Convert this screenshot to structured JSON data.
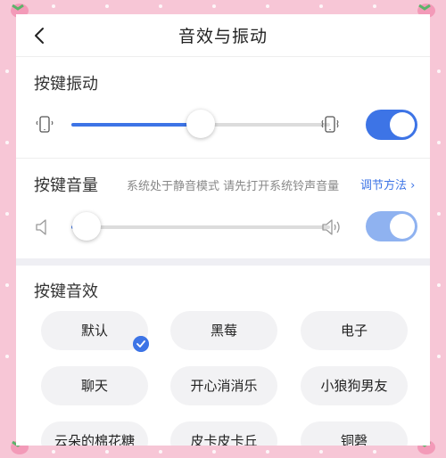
{
  "header": {
    "title": "音效与振动",
    "back_icon": "chevron-left-icon"
  },
  "vibration": {
    "title": "按键振动",
    "slider_level": 0.5,
    "toggle_on": true,
    "left_icon": "phone-vibrate-low-icon",
    "right_icon": "phone-vibrate-high-icon"
  },
  "volume": {
    "title": "按键音量",
    "hint": "系统处于静音模式 请先打开系统铃声音量",
    "link_label": "调节方法 ›",
    "slider_level": 0.06,
    "toggle_on": true,
    "left_icon": "speaker-low-icon",
    "right_icon": "speaker-high-icon"
  },
  "sound_effects": {
    "title": "按键音效",
    "selected": "默认",
    "options": [
      "默认",
      "黑莓",
      "电子",
      "聊天",
      "开心消消乐",
      "小狼狗男友",
      "云朵的棉花糖",
      "皮卡皮卡丘",
      "铜磬"
    ]
  },
  "colors": {
    "accent": "#3d74e6",
    "frame": "#f7c6d6"
  }
}
